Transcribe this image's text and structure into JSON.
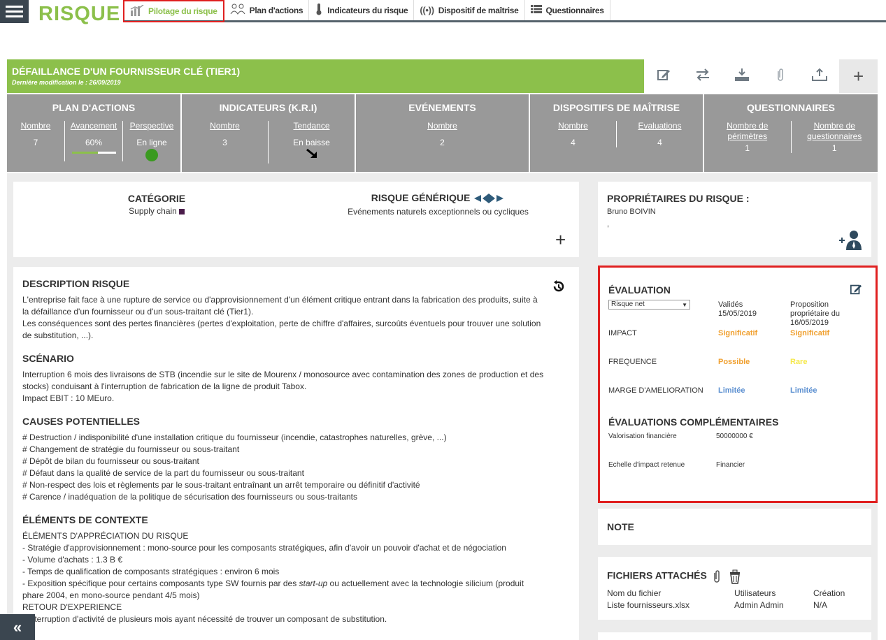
{
  "app": {
    "logo": "RISQUE"
  },
  "tabs": [
    {
      "label": "Pilotage du risque",
      "icon": "chart-icon"
    },
    {
      "label": "Plan d'actions",
      "icon": "people-icon"
    },
    {
      "label": "Indicateurs du risque",
      "icon": "thermometer-icon"
    },
    {
      "label": "Dispositif de maîtrise",
      "icon": "signal-icon"
    },
    {
      "label": "Questionnaires",
      "icon": "list-icon"
    }
  ],
  "risk": {
    "title": "DÉFAILLANCE D'UN FOURNISSEUR CLÉ (TIER1)",
    "last_modified": "Dernière modification le : 26/09/2019"
  },
  "stats": {
    "plan": {
      "title": "PLAN D'ACTIONS",
      "nombre_label": "Nombre",
      "nombre": "7",
      "avancement_label": "Avancement",
      "avancement": "60%",
      "avancement_fraction": 0.6,
      "perspective_label": "Perspective",
      "perspective": "En ligne"
    },
    "indicateurs": {
      "title": "INDICATEURS (K.R.I)",
      "nombre_label": "Nombre",
      "nombre": "3",
      "tendance_label": "Tendance",
      "tendance": "En baisse"
    },
    "evenements": {
      "title": "EVÉNEMENTS",
      "nombre_label": "Nombre",
      "nombre": "2"
    },
    "dispositifs": {
      "title": "DISPOSITIFS DE MAÎTRISE",
      "nombre_label": "Nombre",
      "nombre": "4",
      "evaluations_label": "Evaluations",
      "evaluations": "4"
    },
    "questionnaires": {
      "title": "QUESTIONNAIRES",
      "perimetres_label_1": "Nombre de",
      "perimetres_label_2": "périmètres",
      "perimetres": "1",
      "questionnaires_label_1": "Nombre de",
      "questionnaires_label_2": "questionnaires",
      "questionnaires": "1"
    }
  },
  "categorie": {
    "title": "CATÉGORIE",
    "value": "Supply chain",
    "color": "#4a1c4a"
  },
  "generique": {
    "title": "RISQUE GÉNÉRIQUE",
    "value": "Evénements naturels exceptionnels ou cycliques"
  },
  "description": {
    "title": "DESCRIPTION RISQUE",
    "text1": "L'entreprise fait face à une rupture de service ou d'approvisionnement d'un élément critique entrant dans la fabrication des produits, suite à",
    "text2": "la défaillance d'un fournisseur ou d'un sous-traitant clé (Tier1).",
    "text3": "Les conséquences sont des pertes financières (pertes d'exploitation, perte de chiffre d'affaires, surcoûts éventuels pour trouver une solution",
    "text4": "de substitution, ...)."
  },
  "scenario": {
    "title": "SCÉNARIO",
    "text1": "Interruption 6 mois des livraisons de STB (incendie sur le site de Mourenx / monosource avec contamination des zones de production et des",
    "text2": "stocks) conduisant à l'interruption de fabrication de la ligne de produit Tabox.",
    "text3": "Impact EBIT : 10 MEuro."
  },
  "causes": {
    "title": "CAUSES POTENTIELLES",
    "items": [
      "# Destruction / indisponibilité d'une installation critique du fournisseur (incendie, catastrophes naturelles, grève, ...)",
      "# Changement de stratégie du fournisseur ou sous-traitant",
      "# Dépôt de bilan du fournisseur ou sous-traitant",
      "# Défaut dans la qualité de service de la part du fournisseur ou sous-traitant",
      "# Non-respect des lois et règlements par le sous-traitant entraînant un arrêt temporaire ou définitif d'activité",
      "# Carence / inadéquation de la politique de sécurisation des fournisseurs ou sous-traitants"
    ]
  },
  "contexte": {
    "title": "ÉLÉMENTS DE CONTEXTE",
    "line1": "ÉLÉMENTS D'APPRÉCIATION DU RISQUE",
    "line2": "- Stratégie d'approvisionnement : mono-source pour les composants stratégiques, afin d'avoir un pouvoir d'achat et de négociation",
    "line3": "- Volume d'achats : 1.3 B €",
    "line4": "- Temps de qualification de composants stratégiques : environ 6 mois",
    "line5a": "- Exposition spécifique pour certains composants type SW fournis par des ",
    "line5b": "start-up",
    "line5c": " ou actuellement avec la technologie silicium (produit",
    "line6": "phare 2004, en mono-source pendant 4/5 mois)",
    "line7": "RETOUR D'EXPERIENCE",
    "line8": "- Interruption d'activité de plusieurs mois ayant nécessité de trouver un composant de substitution."
  },
  "owners": {
    "title": "PROPRIÉTAIRES DU RISQUE :",
    "name": "Bruno BOIVIN",
    "extra": ","
  },
  "evaluation": {
    "title": "ÉVALUATION",
    "select": "Risque net",
    "valides_label": "Validés",
    "valides_date": "15/05/2019",
    "proposition_label_1": "Proposition",
    "proposition_label_2": "propriétaire du",
    "proposition_label_3": "16/05/2019",
    "impact_label": "IMPACT",
    "impact_valide": "Significatif",
    "impact_prop": "Significatif",
    "frequence_label": "FREQUENCE",
    "frequence_valide": "Possible",
    "frequence_prop": "Rare",
    "marge_label": "MARGE D'AMELIORATION",
    "marge_valide": "Limitée",
    "marge_prop": "Limitée",
    "comp_title": "ÉVALUATIONS COMPLÉMENTAIRES",
    "valorisation_label": "Valorisation financière",
    "valorisation": "50000000 €",
    "echelle_label": "Echelle d'impact retenue",
    "echelle": "Financier"
  },
  "note": {
    "title": "NOTE"
  },
  "files": {
    "title": "FICHIERS ATTACHÉS",
    "col_name": "Nom du fichier",
    "col_user": "Utilisateurs",
    "col_date": "Création",
    "row_name": "Liste fournisseurs.xlsx",
    "row_user": "Admin Admin",
    "row_date": "N/A"
  },
  "colors": {
    "brand": "#8cc04b",
    "stats_bg": "#999999",
    "highlight": "#e02020",
    "orange": "#f0a030",
    "yellow": "#f5e84a",
    "blue": "#5b8fd0"
  }
}
